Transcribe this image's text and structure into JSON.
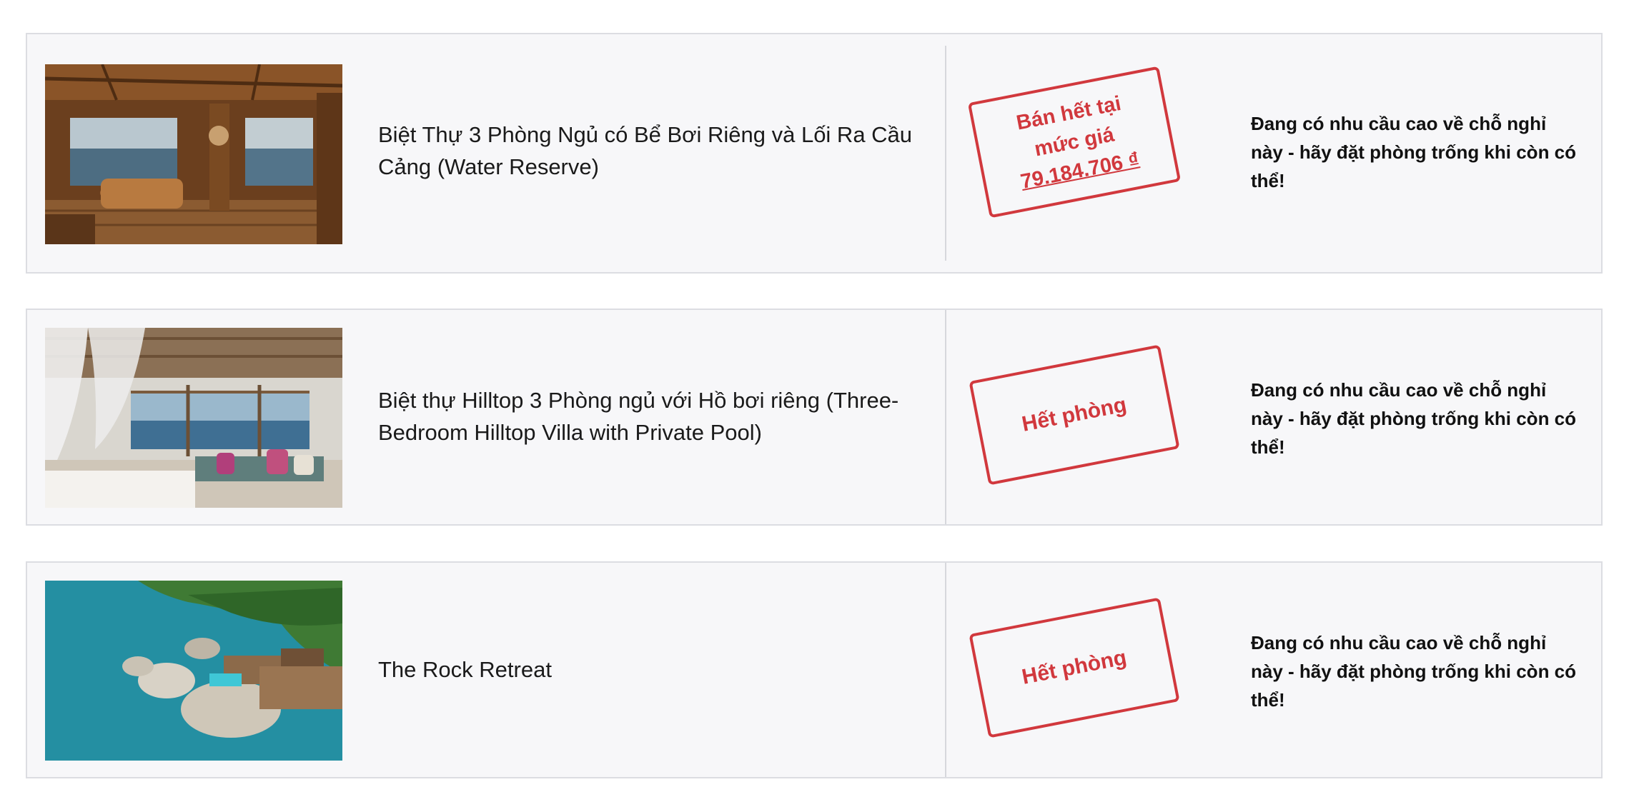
{
  "rooms": [
    {
      "name": "Biệt Thự 3 Phòng Ngủ có Bể Bơi Riêng và Lối Ra Cầu Cảng (Water Reserve)",
      "stamp": {
        "line1": "Bán hết tại",
        "line2": "mức giá",
        "price": "79.184.706 ₫"
      },
      "notice": "Đang có nhu cầu cao về chỗ nghỉ này - hãy đặt phòng trống khi còn có thể!"
    },
    {
      "name": "Biệt thự Hilltop 3 Phòng ngủ với Hồ bơi riêng (Three-Bedroom Hilltop Villa with Private Pool)",
      "stamp": {
        "label": "Hết phòng"
      },
      "notice": "Đang có nhu cầu cao về chỗ nghỉ này - hãy đặt phòng trống khi còn có thể!"
    },
    {
      "name": "The Rock Retreat",
      "stamp": {
        "label": "Hết phòng"
      },
      "notice": "Đang có nhu cầu cao về chỗ nghỉ này - hãy đặt phòng trống khi còn có thể!"
    }
  ],
  "colors": {
    "stamp_red": "#d1383d",
    "card_bg": "#f7f7f9",
    "card_border": "#dcdde2"
  }
}
